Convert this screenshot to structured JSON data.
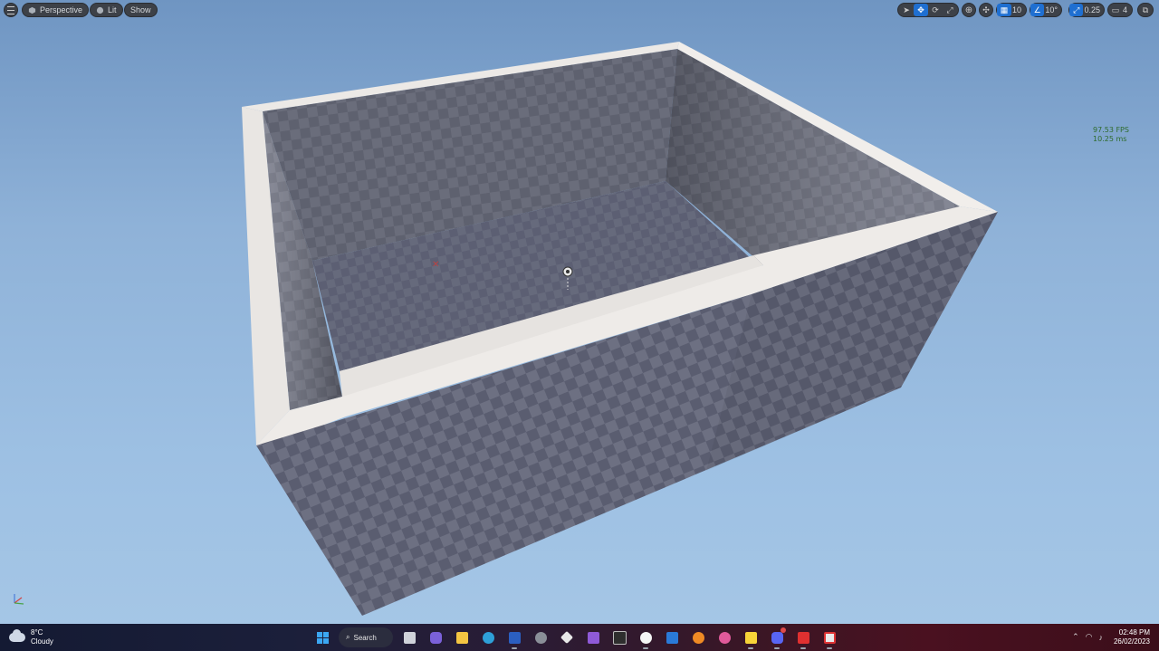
{
  "viewport": {
    "view_mode": "Perspective",
    "lighting": "Lit",
    "show": "Show",
    "grid_snap": "10",
    "rotation_snap": "10°",
    "scale_snap": "0.25",
    "camera_speed": "4"
  },
  "stats": {
    "fps": "97.53 FPS",
    "ms": "10.25 ms"
  },
  "taskbar": {
    "weather_temp": "8°C",
    "weather_desc": "Cloudy",
    "search_label": "Search",
    "time": "02:48 PM",
    "date": "26/02/2023"
  },
  "colors": {
    "sky_top": "#6f95c2",
    "sky_bottom": "#a6c7e6",
    "wall_top": "#ece9e6",
    "wall_outer": "#55586a",
    "wall_inner": "#676a78",
    "floor": "#5d6072",
    "accent_active": "#1f6fd1"
  },
  "icons": {
    "menu": "hamburger-icon",
    "perspective": "cube-icon",
    "lit": "sphere-icon",
    "select": "cursor-icon",
    "translate": "move-icon",
    "rotate": "rotate-icon",
    "scale": "scale-icon",
    "world": "globe-icon",
    "surface_snap": "surface-snap-icon",
    "grid": "grid-icon",
    "angle": "angle-icon",
    "scale_snap": "scale-arrow-icon",
    "camera": "camera-icon",
    "maximize": "maximize-icon"
  }
}
